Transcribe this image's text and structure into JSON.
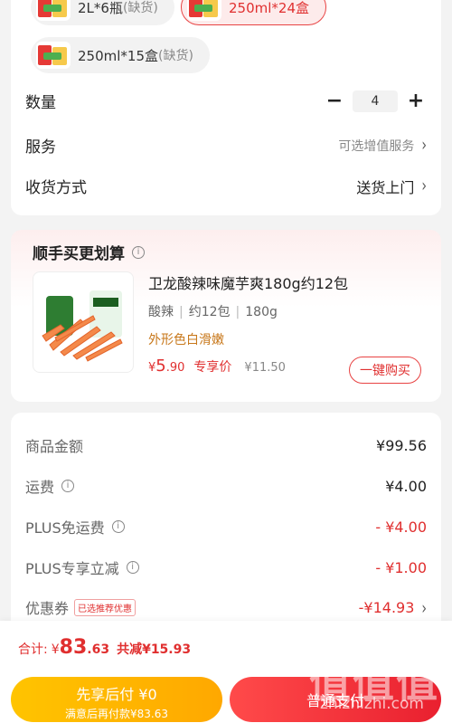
{
  "variants": [
    {
      "label": "2L*6瓶",
      "status": "(缺货)",
      "selected": false
    },
    {
      "label": "250ml*24盒",
      "status": "",
      "selected": true
    },
    {
      "label": "250ml*15盒",
      "status": "(缺货)",
      "selected": false
    }
  ],
  "quantity": {
    "label": "数量",
    "value": "4",
    "minus": "−",
    "plus": "+"
  },
  "service": {
    "label": "服务",
    "value": "可选增值服务"
  },
  "delivery": {
    "label": "收货方式",
    "value": "送货上门"
  },
  "recommend": {
    "title": "顺手买更划算",
    "name": "卫龙酸辣味魔芋爽180g约12包",
    "tags": [
      "酸辣",
      "约12包",
      "180g"
    ],
    "note": "外形色白滑嫩",
    "price_yen": "¥",
    "price_int": "5",
    "price_dec": ".90",
    "price_tag": "专享价",
    "old_price": "¥11.50",
    "buy_label": "一键购买"
  },
  "summary": {
    "goods": {
      "label": "商品金额",
      "value": "¥99.56"
    },
    "shipping": {
      "label": "运费",
      "value": "¥4.00"
    },
    "plus_free_shipping": {
      "label": "PLUS免运费",
      "value": "- ¥4.00"
    },
    "plus_discount": {
      "label": "PLUS专享立减",
      "value": "- ¥1.00"
    },
    "coupon": {
      "label": "优惠券",
      "badge": "已选推荐优惠",
      "value": "-¥14.93"
    }
  },
  "footer": {
    "total_label": "合计:",
    "total_yen": "¥",
    "total_int": "83",
    "total_dec": ".63",
    "saving": "共减¥15.93",
    "pay_later_title": "先享后付 ¥0",
    "pay_later_sub": "满意后再付款¥83.63",
    "pay_label": "普通支付"
  },
  "watermark": {
    "text": "zhizhizhi.com"
  },
  "colors": {
    "accent": "#e02f2f",
    "pay_later": "#ffb400",
    "note": "#c8781b"
  }
}
